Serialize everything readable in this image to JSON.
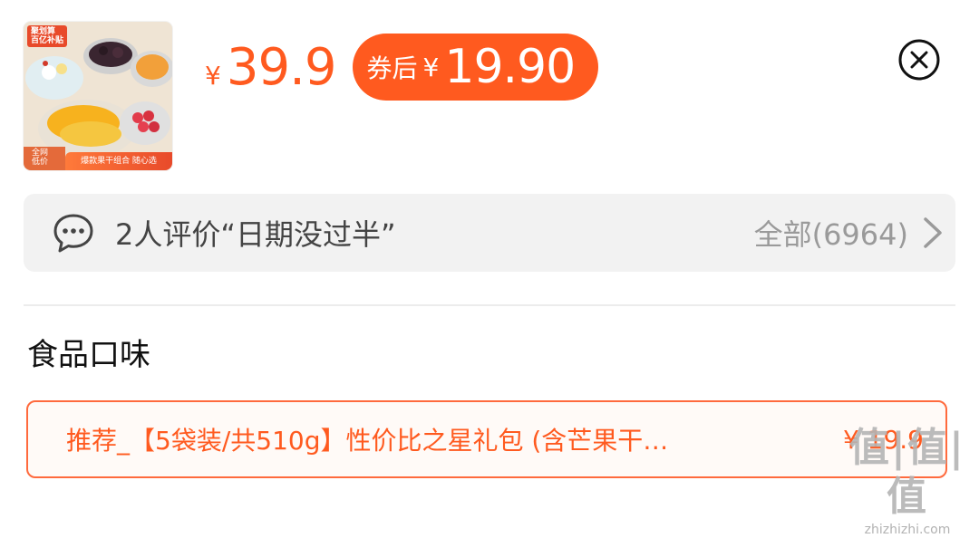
{
  "product": {
    "thumbnail_badge": "聚划算\n百亿补贴",
    "thumbnail_corner_tag": "全网\n低价",
    "thumbnail_banner": "爆款果干组合 随心选",
    "price_currency": "¥",
    "price": "39.9",
    "coupon_label": "券后",
    "coupon_currency": "¥",
    "coupon_price": "19.90"
  },
  "close_icon": "close-circle-icon",
  "review": {
    "icon": "chat-bubble-icon",
    "text": "2人评价“日期没过半”",
    "all_label": "全部(6964)",
    "chevron_icon": "chevron-right-icon"
  },
  "section": {
    "title": "食品口味"
  },
  "option": {
    "name": "推荐_【5袋装/共510g】性价比之星礼包 (含芒果干…",
    "price": "¥ 19.9"
  },
  "watermark": {
    "main": "值|值|值",
    "sub": "zhizhizhi.com"
  },
  "colors": {
    "accent": "#ff5a1f",
    "review_bg": "#f2f2f2",
    "option_border": "#ff6a3d"
  }
}
